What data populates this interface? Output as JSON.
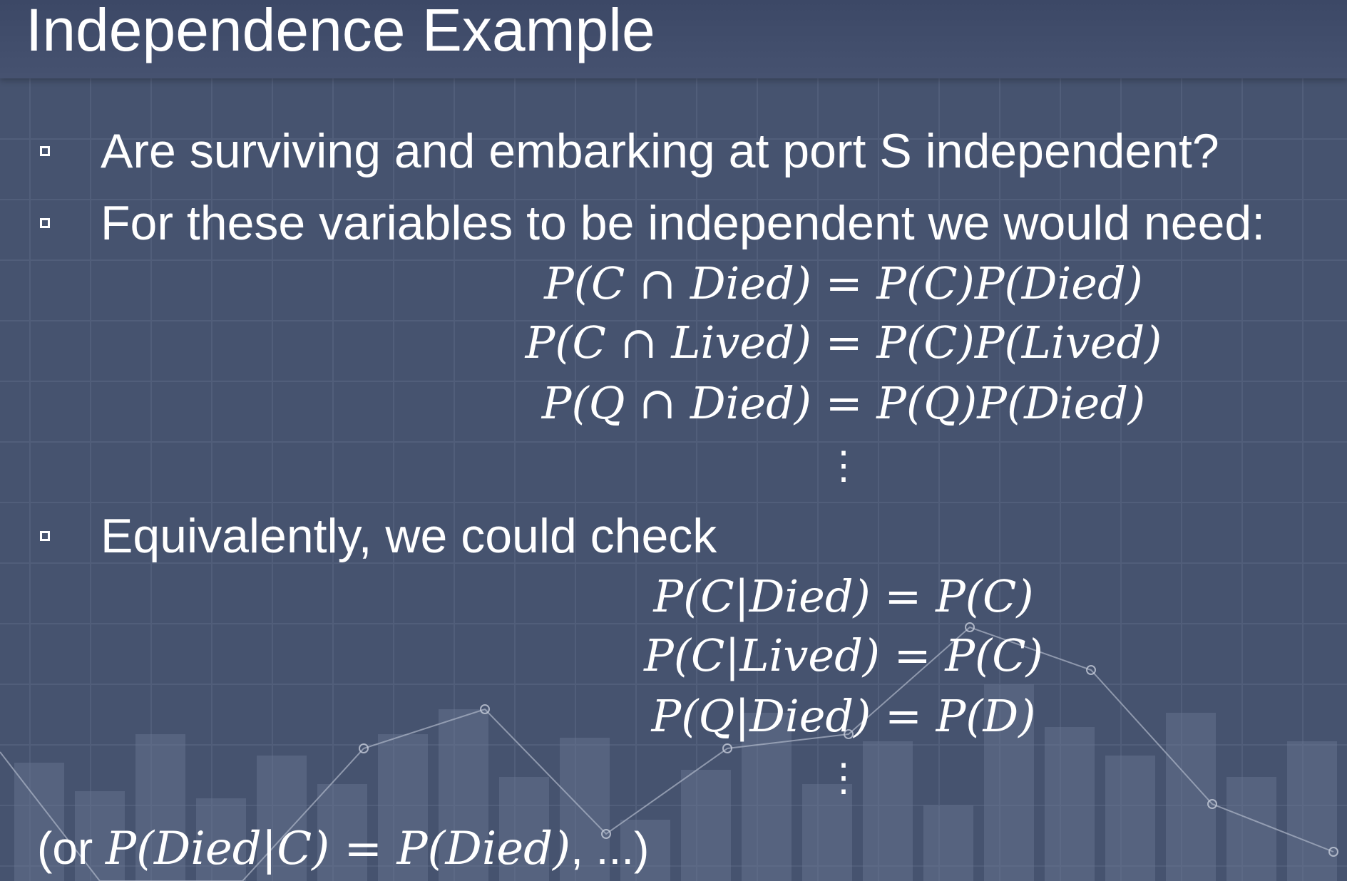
{
  "slide": {
    "title": "Independence Example",
    "bullets": [
      "Are surviving and embarking at port S independent?",
      "For these variables to be independent we would need:",
      "Equivalently, we could check"
    ],
    "equations_joint": [
      "P(C ∩ Died) = P(C)P(Died)",
      "P(C ∩ Lived) = P(C)P(Lived)",
      "P(Q ∩ Died) = P(Q)P(Died)"
    ],
    "equations_conditional": [
      "P(C|Died) = P(C)",
      "P(C|Lived) = P(C)",
      "P(Q|Died) = P(D)"
    ],
    "ellipsis": "⋮",
    "footnote_prefix": "(or ",
    "footnote_math": "P(Died|C) = P(Died)",
    "footnote_suffix": ", ...)"
  },
  "colors": {
    "background": "#46536f",
    "title_bar": "#3c4866",
    "text": "#ffffff"
  }
}
